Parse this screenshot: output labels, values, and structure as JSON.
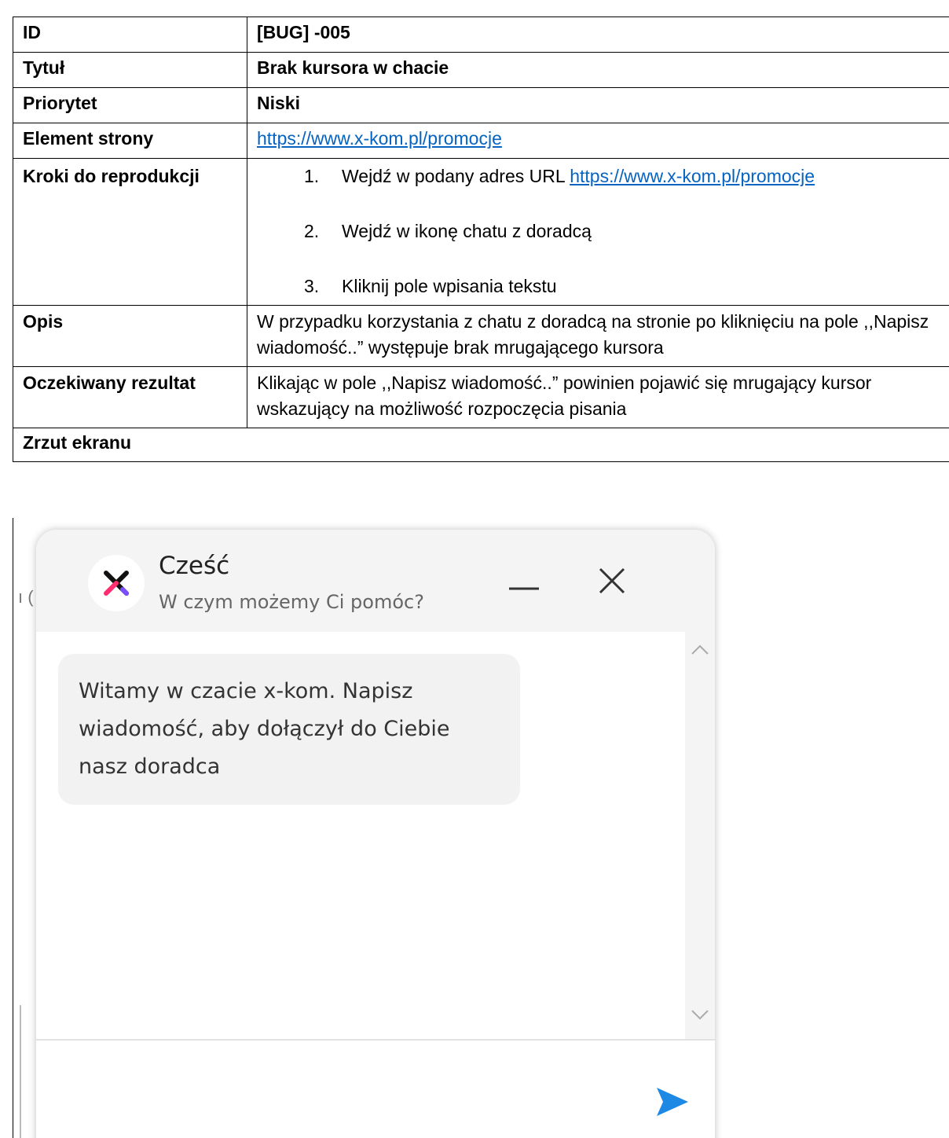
{
  "rows": {
    "id": {
      "key": "ID",
      "value": "[BUG] -005"
    },
    "title": {
      "key": "Tytuł",
      "value": "Brak kursora w chacie"
    },
    "priority": {
      "key": "Priorytet",
      "value": "Niski"
    },
    "element": {
      "key": "Element strony",
      "link": "https://www.x-kom.pl/promocje"
    },
    "steps": {
      "key": "Kroki do reprodukcji",
      "items": [
        {
          "num": "1.",
          "text": "Wejdź w podany adres URL ",
          "link": "https://www.x-kom.pl/promocje"
        },
        {
          "num": "2.",
          "text": "Wejdź w ikonę chatu z doradcą"
        },
        {
          "num": "3.",
          "text": "Kliknij  pole wpisania tekstu"
        }
      ]
    },
    "description": {
      "key": "Opis",
      "value": "W przypadku korzystania z chatu z doradcą na stronie po kliknięciu na pole ,,Napisz wiadomość..” występuje brak mrugającego kursora"
    },
    "expected": {
      "key": "Oczekiwany rezultat",
      "value": "Klikając w pole ,,Napisz wiadomość..” powinien pojawić się mrugający kursor wskazujący na możliwość rozpoczęcia pisania"
    },
    "screenshot": {
      "key": "Zrzut ekranu"
    }
  },
  "chat": {
    "greeting": "Cześć",
    "subtitle": "W czym możemy Ci pomóc?",
    "welcome_message": "Witamy w czacie x-kom. Napisz wiadomość, aby dołączył do Ciebie nasz doradca",
    "input_value": "",
    "background_fragment": "ı (",
    "colors": {
      "accent_blue": "#1e88e5",
      "logo_pink": "#ff2d6f",
      "logo_purple": "#7c4dff"
    }
  }
}
